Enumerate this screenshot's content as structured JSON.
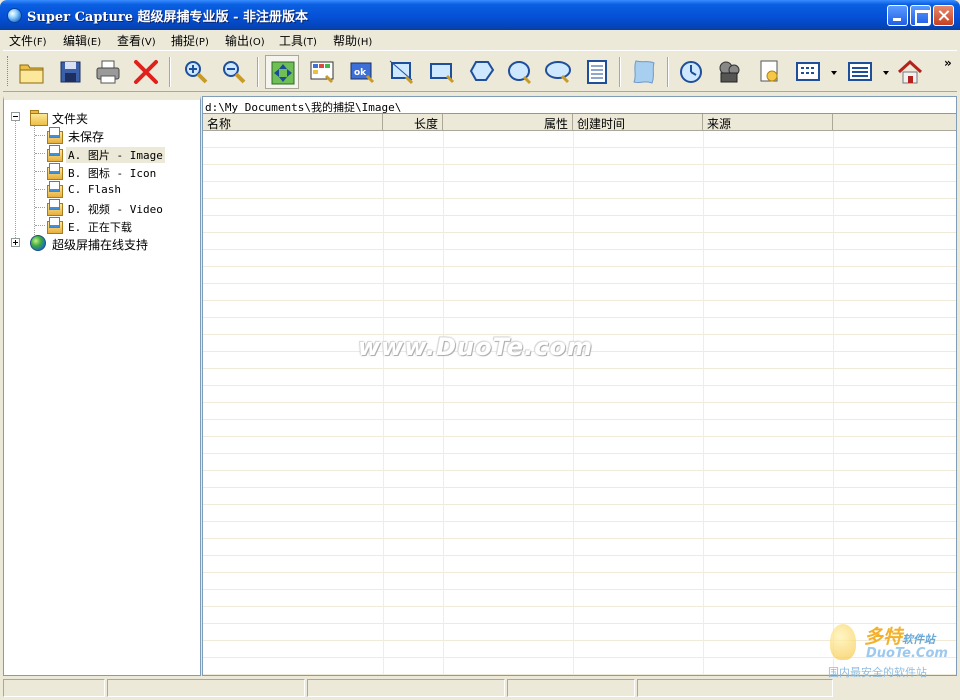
{
  "window": {
    "title": "Super Capture 超级屏捕专业版 - 非注册版本",
    "app_icon": "capture-app-icon"
  },
  "menu": [
    {
      "label": "文件",
      "key": "(F)"
    },
    {
      "label": "编辑",
      "key": "(E)"
    },
    {
      "label": "查看",
      "key": "(V)"
    },
    {
      "label": "捕捉",
      "key": "(P)"
    },
    {
      "label": "输出",
      "key": "(O)"
    },
    {
      "label": "工具",
      "key": "(T)"
    },
    {
      "label": "帮助",
      "key": "(H)"
    }
  ],
  "toolbar": {
    "icons": [
      "open-folder-icon",
      "save-disk-icon",
      "printer-icon",
      "delete-x-icon",
      "zoom-in-icon",
      "zoom-out-icon",
      "move-arrows-icon",
      "grid-capture-icon",
      "ok-capture-icon",
      "region-capture-icon",
      "window-capture-icon",
      "polygon-capture-icon",
      "ellipse-capture-icon",
      "round-capture-icon",
      "scroll-capture-icon",
      "freehand-capture-icon",
      "timer-capture-icon",
      "video-capture-icon",
      "image-export-icon",
      "view-mode-icon",
      "detail-view-icon",
      "home-icon"
    ],
    "overflow": "»"
  },
  "tree": {
    "root": {
      "label": "文件夹"
    },
    "items": [
      {
        "label": "未保存"
      },
      {
        "label": "A. 图片 - Image"
      },
      {
        "label": "B. 图标 - Icon"
      },
      {
        "label": "C. Flash"
      },
      {
        "label": "D. 视频 - Video"
      },
      {
        "label": "E. 正在下载"
      }
    ],
    "online": {
      "label": "超级屏捕在线支持"
    }
  },
  "list": {
    "path": "d:\\My Documents\\我的捕捉\\Image\\",
    "columns": [
      {
        "label": "名称"
      },
      {
        "label": "长度"
      },
      {
        "label": "属性"
      },
      {
        "label": "创建时间"
      },
      {
        "label": "来源"
      }
    ]
  },
  "watermark": {
    "text": "www.DuoTe.com"
  },
  "corner_logo": {
    "line1": "多特",
    "line1_small": "软件站",
    "line2": "DuoTe.Com",
    "line3": "国内最安全的软件站"
  },
  "colors": {
    "titlebar": "#0551D8",
    "chrome": "#ECE9D8",
    "border": "#7F9DB9"
  }
}
